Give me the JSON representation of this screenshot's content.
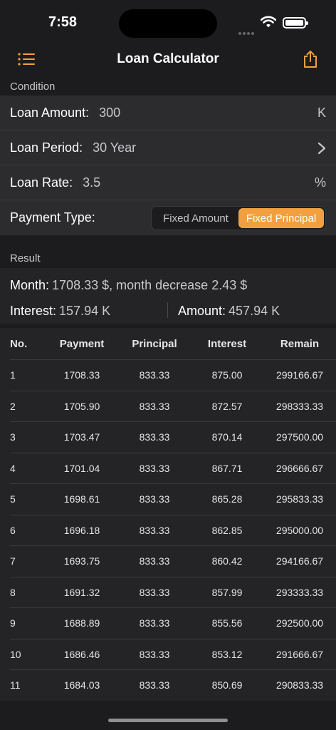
{
  "status": {
    "time": "7:58"
  },
  "nav": {
    "title": "Loan Calculator",
    "menu_icon": "list-icon",
    "share_icon": "share-icon"
  },
  "sections": {
    "condition": "Condition",
    "result": "Result"
  },
  "form": {
    "loan_amount": {
      "label": "Loan Amount:",
      "value": "300",
      "unit": "K"
    },
    "loan_period": {
      "label": "Loan Period:",
      "value": "30 Year"
    },
    "loan_rate": {
      "label": "Loan Rate:",
      "value": "3.5",
      "unit": "%"
    },
    "payment_type": {
      "label": "Payment Type:",
      "options": [
        "Fixed Amount",
        "Fixed Principal"
      ],
      "selected": "Fixed Principal"
    }
  },
  "result": {
    "month_label": "Month:",
    "month_value": "1708.33 $, month decrease 2.43 $",
    "interest_label": "Interest:",
    "interest_value": "157.94 K",
    "amount_label": "Amount:",
    "amount_value": "457.94 K"
  },
  "table": {
    "headers": [
      "No.",
      "Payment",
      "Principal",
      "Interest",
      "Remain"
    ],
    "rows": [
      [
        "1",
        "1708.33",
        "833.33",
        "875.00",
        "299166.67"
      ],
      [
        "2",
        "1705.90",
        "833.33",
        "872.57",
        "298333.33"
      ],
      [
        "3",
        "1703.47",
        "833.33",
        "870.14",
        "297500.00"
      ],
      [
        "4",
        "1701.04",
        "833.33",
        "867.71",
        "296666.67"
      ],
      [
        "5",
        "1698.61",
        "833.33",
        "865.28",
        "295833.33"
      ],
      [
        "6",
        "1696.18",
        "833.33",
        "862.85",
        "295000.00"
      ],
      [
        "7",
        "1693.75",
        "833.33",
        "860.42",
        "294166.67"
      ],
      [
        "8",
        "1691.32",
        "833.33",
        "857.99",
        "293333.33"
      ],
      [
        "9",
        "1688.89",
        "833.33",
        "855.56",
        "292500.00"
      ],
      [
        "10",
        "1686.46",
        "833.33",
        "853.12",
        "291666.67"
      ],
      [
        "11",
        "1684.03",
        "833.33",
        "850.69",
        "290833.33"
      ]
    ]
  },
  "colors": {
    "accent": "#f2a03f",
    "background": "#1c1c1e",
    "card": "#2c2c2e"
  }
}
